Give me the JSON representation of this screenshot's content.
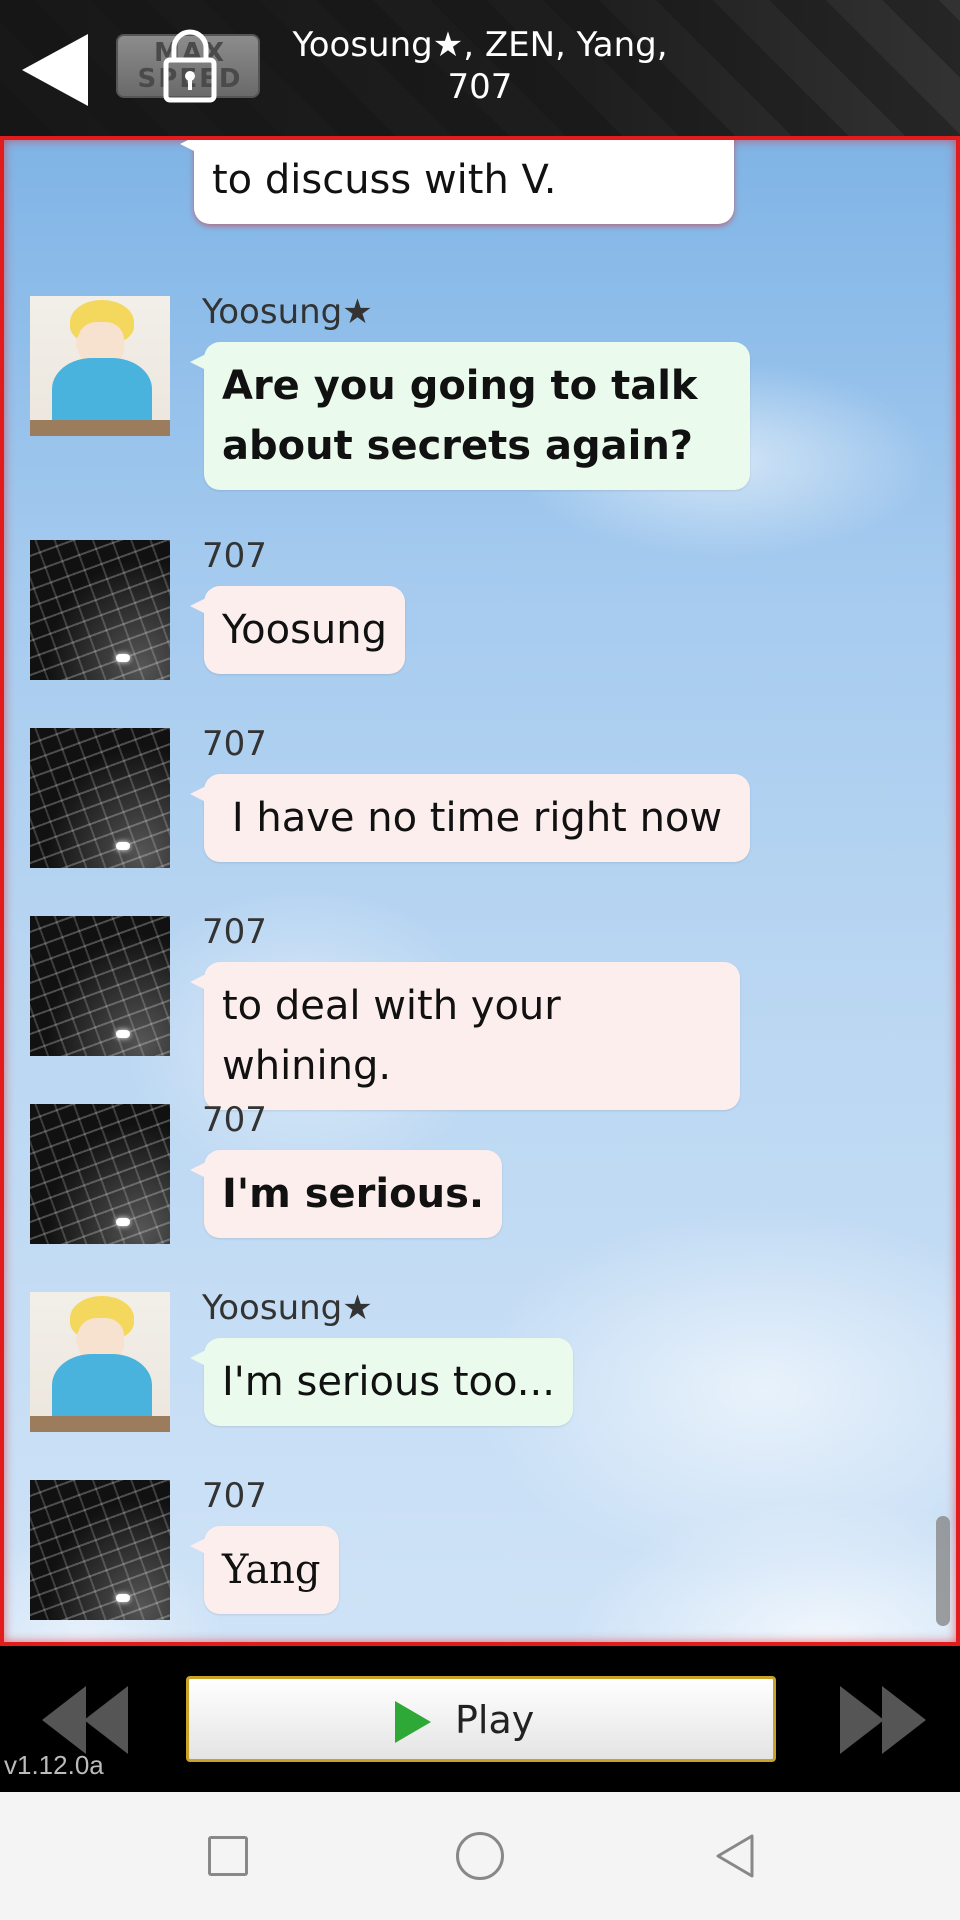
{
  "header": {
    "room_title_line1": "Yoosung★, ZEN, Yang,",
    "room_title_line2": "707",
    "speed_label": "MAX SPEED"
  },
  "chat": {
    "top_partial": "to discuss with V.",
    "messages": [
      {
        "sender": "Yoosung★",
        "text_line1": "Are you going to talk",
        "text_line2": "about secrets again?"
      },
      {
        "sender": "707",
        "text": "Yoosung"
      },
      {
        "sender": "707",
        "text": "I have no time right now"
      },
      {
        "sender": "707",
        "text": "to deal with your whining."
      },
      {
        "sender": "707",
        "text": "I'm serious."
      },
      {
        "sender": "Yoosung★",
        "text": "I'm serious too..."
      },
      {
        "sender": "707",
        "text": "Yang"
      }
    ]
  },
  "controls": {
    "play_label": "Play",
    "version": "v1.12.0a"
  },
  "colors": {
    "border_accent": "#e21c1c",
    "bubble_green": "#eafbee",
    "bubble_pink": "#fdeeee",
    "play_border": "#c9a227"
  },
  "icons": [
    "back-arrow-icon",
    "lock-icon",
    "play-icon",
    "rewind-icon",
    "fast-forward-icon"
  ]
}
